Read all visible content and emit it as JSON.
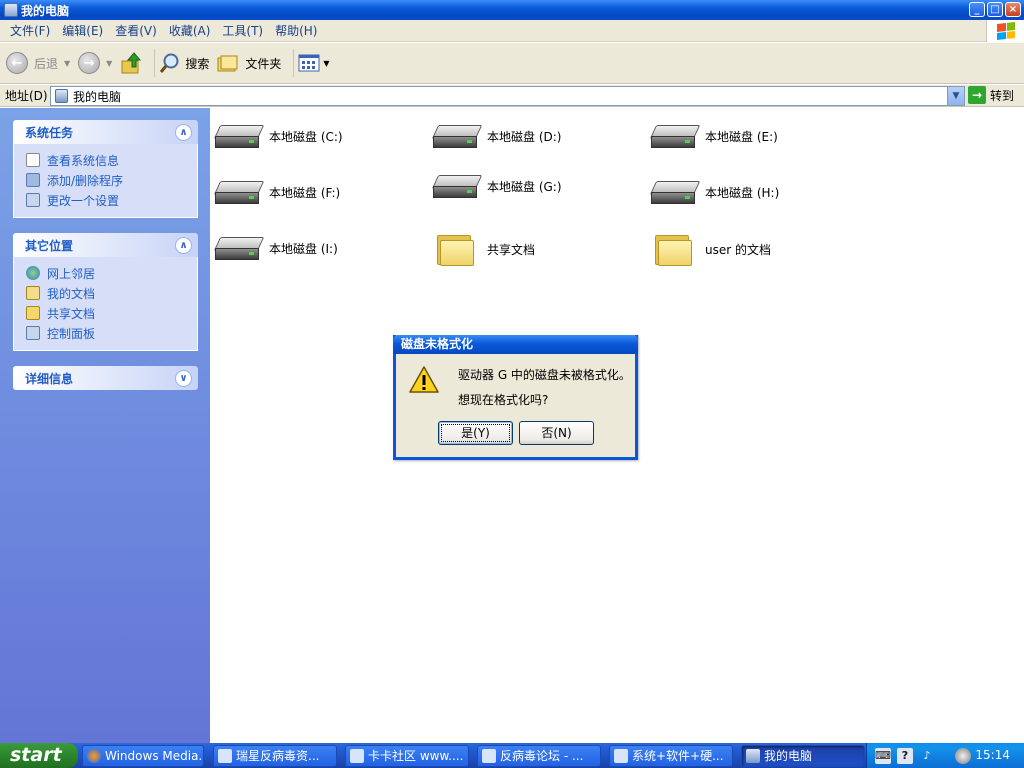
{
  "window": {
    "title": "我的电脑",
    "controls": {
      "minimize": "_",
      "maximize": "□",
      "close": "×"
    }
  },
  "menu": [
    "文件(F)",
    "编辑(E)",
    "查看(V)",
    "收藏(A)",
    "工具(T)",
    "帮助(H)"
  ],
  "toolbar": {
    "back_label": "后退",
    "search_label": "搜索",
    "folders_label": "文件夹"
  },
  "address": {
    "label": "地址(D)",
    "value": "我的电脑",
    "go_label": "转到"
  },
  "left_panels": {
    "system_tasks": {
      "title": "系统任务",
      "items": [
        "查看系统信息",
        "添加/删除程序",
        "更改一个设置"
      ]
    },
    "other_places": {
      "title": "其它位置",
      "items": [
        "网上邻居",
        "我的文档",
        "共享文档",
        "控制面板"
      ]
    },
    "details": {
      "title": "详细信息"
    }
  },
  "items": [
    {
      "label": "本地磁盘 (C:)",
      "icon": "hard-drive-icon"
    },
    {
      "label": "本地磁盘 (D:)",
      "icon": "hard-drive-icon"
    },
    {
      "label": "本地磁盘 (E:)",
      "icon": "hard-drive-icon"
    },
    {
      "label": "本地磁盘 (F:)",
      "icon": "hard-drive-icon"
    },
    {
      "label": "本地磁盘 (G:)",
      "icon": "hard-drive-icon"
    },
    {
      "label": "本地磁盘 (H:)",
      "icon": "hard-drive-icon"
    },
    {
      "label": "本地磁盘 (I:)",
      "icon": "hard-drive-icon"
    },
    {
      "label": "共享文档",
      "icon": "folder-icon"
    },
    {
      "label": "user 的文档",
      "icon": "folder-icon"
    }
  ],
  "dialog": {
    "title": "磁盘未格式化",
    "line1": "驱动器 G 中的磁盘未被格式化。",
    "line2": "想现在格式化吗?",
    "yes_label": "是(Y)",
    "no_label": "否(N)"
  },
  "taskbar": {
    "start_label": "start",
    "tasks": [
      {
        "label": "Windows Media..."
      },
      {
        "label": "瑞星反病毒资..."
      },
      {
        "label": "卡卡社区 www...."
      },
      {
        "label": "反病毒论坛 - ..."
      },
      {
        "label": "系统+软件+硬..."
      },
      {
        "label": "我的电脑"
      }
    ],
    "tray_help_glyph": "?",
    "clock": "15:14"
  },
  "colors": {
    "xp_blue": "#0a5ad9",
    "left_pane": "#6f8fe0",
    "panel_link": "#215dc6",
    "start_green": "#2e8a2e"
  }
}
